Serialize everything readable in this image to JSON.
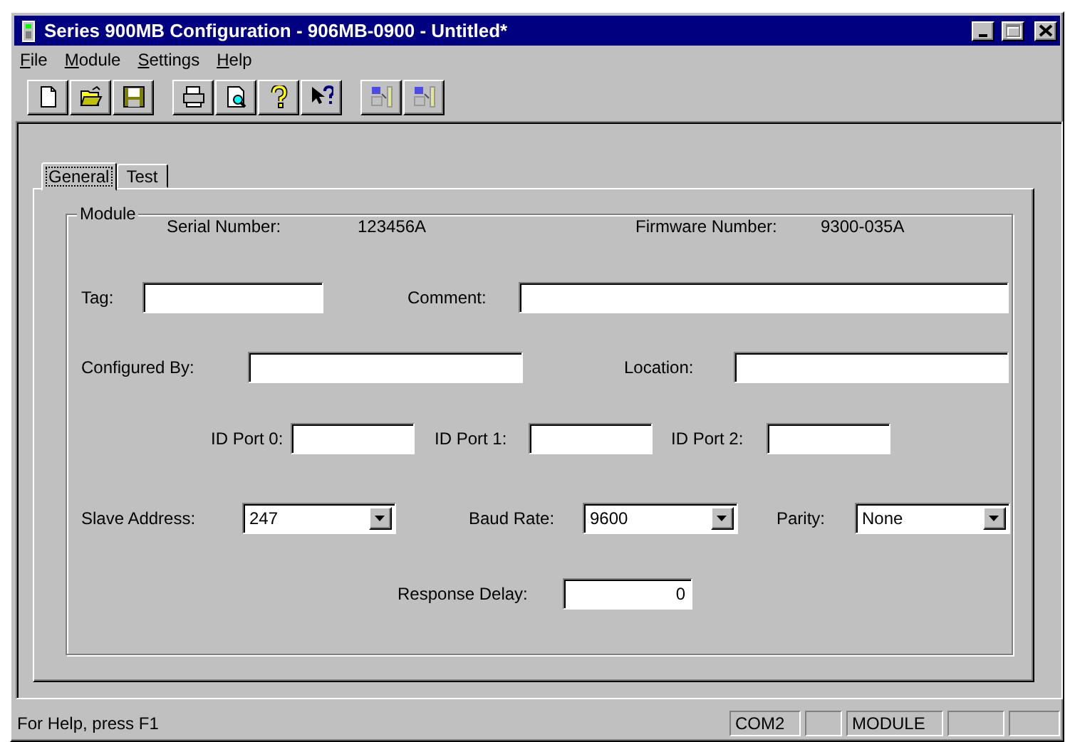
{
  "window": {
    "title": "Series 900MB Configuration - 906MB-0900 - Untitled*",
    "controls": [
      {
        "kind": "minimize",
        "disabled": false
      },
      {
        "kind": "maximize",
        "disabled": true
      },
      {
        "kind": "close",
        "disabled": false
      }
    ]
  },
  "menu": [
    {
      "label": "File"
    },
    {
      "label": "Module"
    },
    {
      "label": "Settings"
    },
    {
      "label": "Help"
    }
  ],
  "toolbar": [
    {
      "kind": "new",
      "disabled": false
    },
    {
      "kind": "open",
      "disabled": false
    },
    {
      "kind": "save",
      "disabled": false
    },
    {
      "kind": "separator"
    },
    {
      "kind": "print",
      "disabled": false
    },
    {
      "kind": "preview",
      "disabled": false
    },
    {
      "kind": "help",
      "disabled": false
    },
    {
      "kind": "context-help",
      "disabled": false
    },
    {
      "kind": "separator"
    },
    {
      "kind": "read",
      "disabled": true
    },
    {
      "kind": "write",
      "disabled": true
    }
  ],
  "tabs": [
    {
      "label": "General",
      "selected": true
    },
    {
      "label": "Test",
      "selected": false
    }
  ],
  "group": {
    "title": "Module",
    "info": [
      {
        "label": "Serial Number:",
        "value": "123456A"
      },
      {
        "label": "Firmware Number:",
        "value": "9300-035A"
      }
    ],
    "rows": [
      [
        {
          "kind": "text",
          "label": "Tag:"
        },
        {
          "kind": "text",
          "label": "Comment:"
        }
      ],
      [
        {
          "kind": "text",
          "label": "Configured By:"
        },
        {
          "kind": "text",
          "label": "Location:"
        }
      ],
      [
        {
          "kind": "text",
          "label": "ID Port 0:"
        },
        {
          "kind": "text",
          "label": "ID Port 1:"
        },
        {
          "kind": "text",
          "label": "ID Port 2:"
        }
      ],
      [
        {
          "kind": "combo",
          "label": "Slave Address:",
          "value": "247"
        },
        {
          "kind": "combo",
          "label": "Baud Rate:",
          "value": "9600"
        },
        {
          "kind": "combo",
          "label": "Parity:",
          "value": "None"
        }
      ]
    ],
    "response_delay": {
      "label": "Response Delay:",
      "value": "0"
    }
  },
  "status_bar": {
    "text": "For Help, press F1",
    "panels": [
      {
        "kind": "text",
        "text": "COM2"
      },
      {
        "kind": "blank"
      },
      {
        "kind": "text",
        "text": "MODULE"
      },
      {
        "kind": "blank"
      },
      {
        "kind": "blank"
      }
    ]
  }
}
